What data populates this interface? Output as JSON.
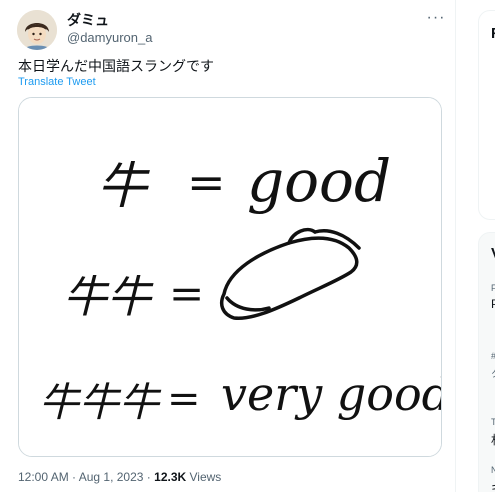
{
  "user": {
    "name": "ダミュ",
    "handle": "@damyuron_a"
  },
  "tweet": {
    "text": "本日学んだ中国語スラングです",
    "translate_label": "Translate Tweet",
    "more_label": "···"
  },
  "image": {
    "line1_left": "牛",
    "line1_right": "good",
    "line2_left": "牛牛",
    "line3_left": "牛牛牛",
    "line3_right": "very good",
    "equals": "="
  },
  "meta": {
    "time": "12:00 AM",
    "separator": "·",
    "date": "Aug 1, 2023",
    "views_count": "12.3K",
    "views_label": "Views"
  },
  "right_column": {
    "card1_glyph": "F",
    "card2_glyph": "V",
    "row1": "F",
    "row2": "P",
    "row3": "#",
    "row4": "ク",
    "row5": "T",
    "row6": "村",
    "row7": "N",
    "row8": "キ"
  }
}
